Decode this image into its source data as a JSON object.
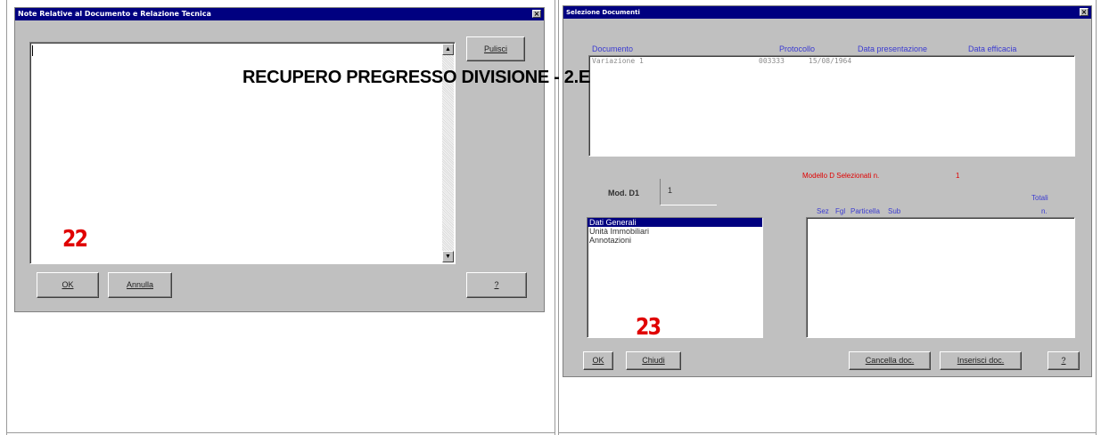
{
  "overlay_title": "RECUPERO PREGRESSO DIVISIONE - 2.E",
  "left_window": {
    "title": "Note Relative al Documento e Relazione Tecnica",
    "close_glyph": "×",
    "pulisci_label": "Pulisci",
    "ok_label": "OK",
    "annulla_label": "Annulla",
    "help_label": "?",
    "callout": "22",
    "scroll_up": "▲",
    "scroll_down": "▼"
  },
  "right_window": {
    "title": "Selezione Documenti",
    "close_glyph": "×",
    "headers": {
      "documento": "Documento",
      "protocollo": "Protocollo",
      "data_presentazione": "Data presentazione",
      "data_efficacia": "Data efficacia"
    },
    "documents": [
      {
        "documento": "Variazione  1",
        "protocollo": "003333",
        "data_presentazione": "15/08/1964",
        "data_efficacia": ""
      }
    ],
    "modello_label": "Modello D Selezionati n.",
    "modello_count": "1",
    "mod_d1_label": "Mod. D1",
    "mod_d1_value": "1",
    "totali_label": "Totali",
    "totali_n": "n.",
    "grid_headers": {
      "sez": "Sez",
      "fgl": "Fgl",
      "particella": "Particella",
      "sub": "Sub"
    },
    "sections": [
      "Dati Generali",
      "Unità Immobiliari",
      "Annotazioni"
    ],
    "selected_section": 0,
    "callout": "23",
    "ok_label": "OK",
    "chiudi_label": "Chiudi",
    "cancella_label": "Cancella doc.",
    "inserisci_label": "Inserisci doc.",
    "help_label": "?"
  }
}
